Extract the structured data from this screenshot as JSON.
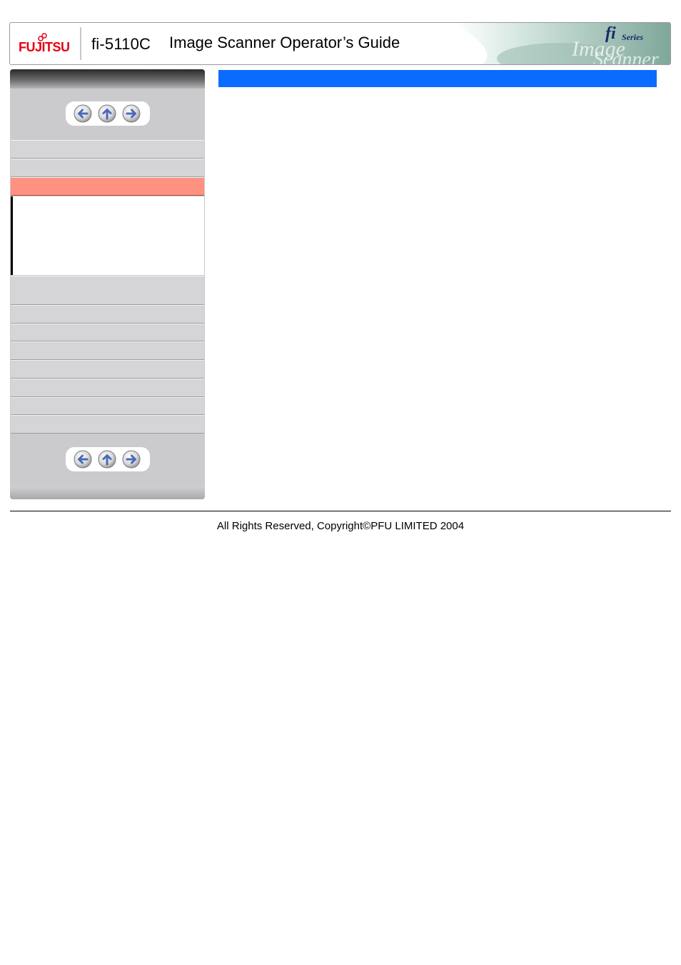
{
  "header": {
    "brand": "FUJITSU",
    "model": "fi-5110C",
    "guide_title": "Image Scanner Operator’s Guide",
    "series_art": {
      "series_label": "Series",
      "watermark": "Image Scanner"
    }
  },
  "sidebar": {
    "top_nav": {
      "back_icon": "arrow-left-icon",
      "up_icon": "arrow-up-icon",
      "next_icon": "arrow-right-icon"
    },
    "items": [
      {
        "label": "",
        "active": false
      },
      {
        "label": "",
        "active": false
      },
      {
        "label": "",
        "active": true
      },
      {
        "label": "",
        "active": false
      },
      {
        "label": "",
        "active": false
      },
      {
        "label": "",
        "active": false
      },
      {
        "label": "",
        "active": false
      },
      {
        "label": "",
        "active": false
      },
      {
        "label": "",
        "active": false
      },
      {
        "label": "",
        "active": false
      },
      {
        "label": "",
        "active": false
      }
    ],
    "bottom_nav": {
      "back_icon": "arrow-left-icon",
      "up_icon": "arrow-up-icon",
      "next_icon": "arrow-right-icon"
    }
  },
  "content": {
    "section_title": ""
  },
  "footer": {
    "copyright": "All Rights Reserved,  Copyright©PFU LIMITED 2004"
  },
  "colors": {
    "brand_red": "#e60012",
    "title_bar": "#0a6cff",
    "active_item": "#ff9180",
    "sidebar_bg": "#cbcbcd",
    "nav_icon": "#4a6ab8"
  }
}
